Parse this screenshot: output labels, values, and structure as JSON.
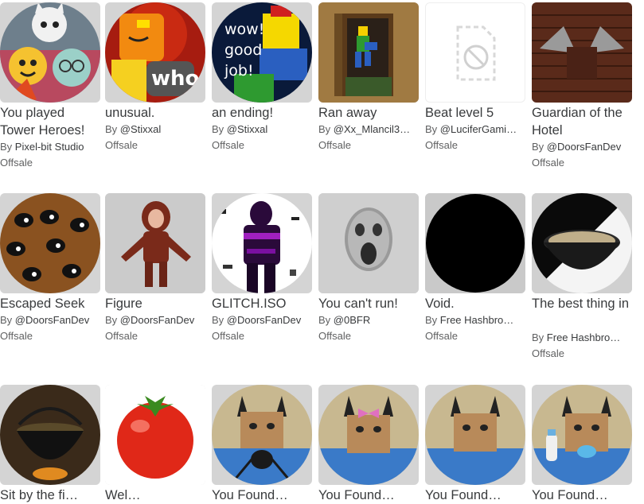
{
  "by_prefix": "By ",
  "items": [
    {
      "name": "You played Tower Heroes!",
      "creator": "Pixel-bit Studio",
      "price": "Offsale",
      "image": "tower-heroes-characters"
    },
    {
      "name": "unusual.",
      "creator": "@Stixxal",
      "price": "Offsale",
      "image": "whoa-character"
    },
    {
      "name": "an ending!",
      "creator": "@Stixxal",
      "price": "Offsale",
      "image": "wow-good-job-character"
    },
    {
      "name": "Ran away",
      "creator": "@Xx_Mlancil3…",
      "price": "Offsale",
      "image": "running-figure-doorway"
    },
    {
      "name": "Beat level 5",
      "creator": "@LuciferGami…",
      "price": "Offsale",
      "image": "unavailable-image-icon"
    },
    {
      "name": "Guardian of the Hotel",
      "creator": "@DoorsFanDev",
      "price": "Offsale",
      "image": "brick-wall-guardian"
    },
    {
      "name": "Escaped Seek",
      "creator": "@DoorsFanDev",
      "price": "Offsale",
      "image": "seek-eyes-wall"
    },
    {
      "name": "Figure",
      "creator": "@DoorsFanDev",
      "price": "Offsale",
      "image": "figure-monster"
    },
    {
      "name": "GLITCH.ISO",
      "creator": "@DoorsFanDev",
      "price": "Offsale",
      "image": "glitch-figure"
    },
    {
      "name": "You can't run!",
      "creator": "@0BFR",
      "price": "Offsale",
      "image": "screaming-face"
    },
    {
      "name": "Void.",
      "creator": "Free Hashbro…",
      "price": "Offsale",
      "image": "black-void"
    },
    {
      "name": "The best thing in",
      "creator": "Free Hashbro…",
      "price": "Offsale",
      "image": "bowl-of-soup"
    },
    {
      "name": "Sit by the fi…",
      "creator": "",
      "price": "",
      "image": "cauldron-fire"
    },
    {
      "name": "Wel…",
      "creator": "",
      "price": "",
      "image": "tomato"
    },
    {
      "name": "You Found…",
      "creator": "",
      "price": "",
      "image": "floppa-spider"
    },
    {
      "name": "You Found…",
      "creator": "",
      "price": "",
      "image": "floppa-bow"
    },
    {
      "name": "You Found…",
      "creator": "",
      "price": "",
      "image": "floppa-plain"
    },
    {
      "name": "You Found…",
      "creator": "",
      "price": "",
      "image": "floppa-baby"
    }
  ]
}
